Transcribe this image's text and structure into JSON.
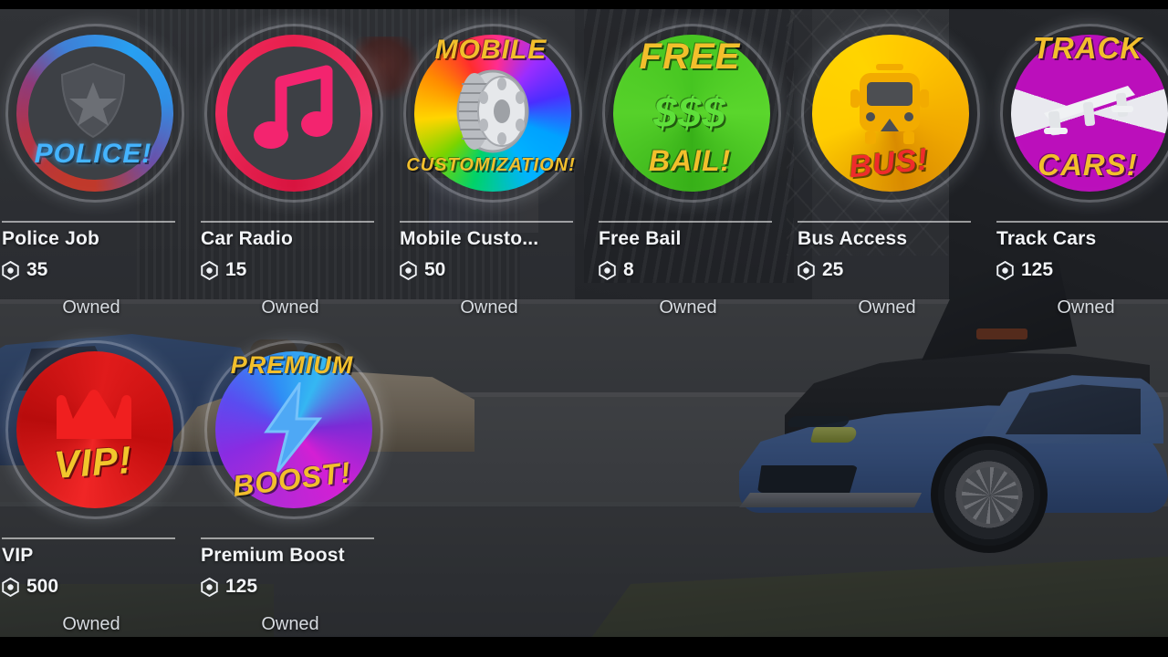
{
  "screen": {
    "kind": "roblox-gamepass-store",
    "currency_icon": "robux-icon",
    "letterbox_color": "#000000"
  },
  "store": {
    "items": [
      {
        "id": "police-job",
        "title": "Police Job",
        "price": "35",
        "status": "Owned",
        "badge": {
          "art_top": "",
          "art_bottom": "POLICE!",
          "icon": "police-shield-icon",
          "ring_style": "police",
          "colors": {
            "ring_a": "#27a0f2",
            "ring_b": "#c0392b",
            "text": "#44b4ff"
          }
        }
      },
      {
        "id": "car-radio",
        "title": "Car Radio",
        "price": "15",
        "status": "Owned",
        "badge": {
          "art_top": "",
          "art_bottom": "",
          "icon": "music-note-icon",
          "ring_style": "music",
          "colors": {
            "ring_a": "#e8204e",
            "ring_b": "#f0376b",
            "text": "#ff2e6b"
          }
        }
      },
      {
        "id": "mobile-customization",
        "title": "Mobile Custo...",
        "price": "50",
        "status": "Owned",
        "badge": {
          "art_top": "MOBILE",
          "art_bottom": "CUSTOMIZATION!",
          "icon": "wheel-tire-icon",
          "ring_style": "rainbow",
          "colors": {
            "ring_a": "#00b3ff",
            "ring_b": "#ff2d2d",
            "text": "#f2bf2c"
          }
        }
      },
      {
        "id": "free-bail",
        "title": "Free Bail",
        "price": "8",
        "status": "Owned",
        "badge": {
          "art_top": "FREE",
          "art_mid": "$$$",
          "art_bottom": "BAIL!",
          "icon": "dollar-signs-icon",
          "ring_style": "green",
          "colors": {
            "ring_a": "#46c521",
            "ring_b": "#5ad62c",
            "text": "#f2bf2c"
          }
        }
      },
      {
        "id": "bus-access",
        "title": "Bus Access",
        "price": "25",
        "status": "Owned",
        "badge": {
          "art_top": "",
          "art_bottom": "BUS!",
          "icon": "bus-icon",
          "ring_style": "yellow",
          "colors": {
            "ring_a": "#ffd400",
            "ring_b": "#d98b00",
            "text": "#ef2b2b"
          }
        }
      },
      {
        "id": "track-cars",
        "title": "Track Cars",
        "price": "125",
        "status": "Owned",
        "badge": {
          "art_top": "TRACK",
          "art_bottom": "CARS!",
          "icon": "rear-spoiler-icon",
          "ring_style": "magenta",
          "colors": {
            "ring_a": "#bb0fbb",
            "ring_b": "#e9e9ef",
            "text": "#f2bf2c"
          }
        }
      },
      {
        "id": "vip",
        "title": "VIP",
        "price": "500",
        "status": "Owned",
        "badge": {
          "art_top": "",
          "art_bottom": "VIP!",
          "icon": "crown-icon",
          "ring_style": "vipred",
          "colors": {
            "ring_a": "#e01b1b",
            "ring_b": "#b80c0c",
            "text": "#f2c62c"
          }
        }
      },
      {
        "id": "premium-boost",
        "title": "Premium Boost",
        "price": "125",
        "status": "Owned",
        "badge": {
          "art_top": "PREMIUM",
          "art_bottom": "BOOST!",
          "icon": "lightning-bolt-icon",
          "ring_style": "premium",
          "colors": {
            "ring_a": "#b12ad6",
            "ring_b": "#35b7f2",
            "text": "#f2bf2c"
          }
        }
      }
    ]
  }
}
